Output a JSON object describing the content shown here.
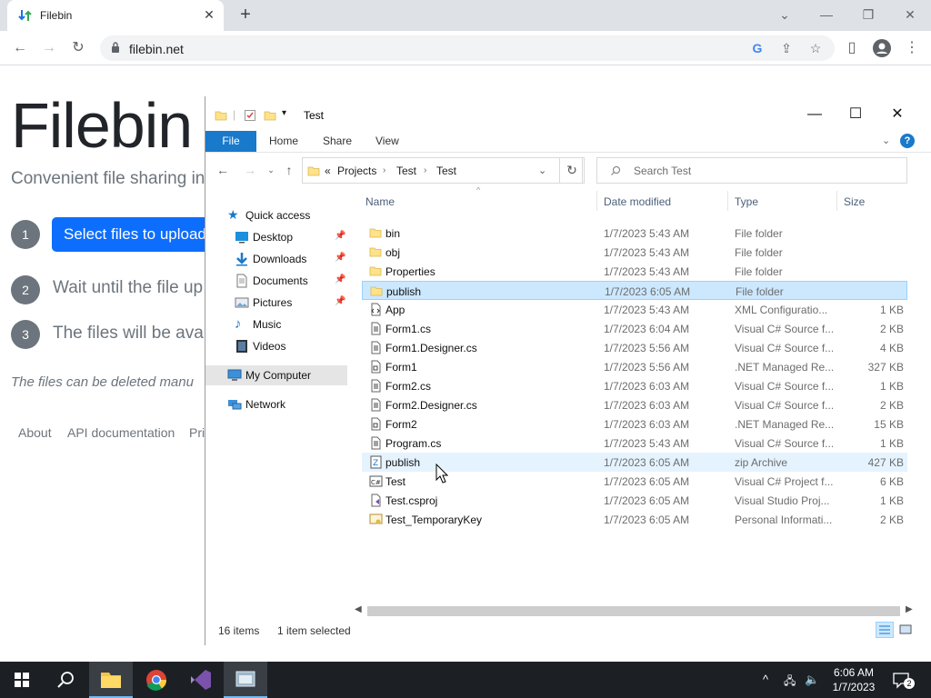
{
  "browser": {
    "tab_title": "Filebin",
    "tab_close": "✕",
    "new_tab": "+",
    "url": "filebin.net"
  },
  "page": {
    "title": "Filebin",
    "tagline": "Convenient file sharing in",
    "steps": [
      {
        "num": "1",
        "label": "Select files to upload"
      },
      {
        "num": "2",
        "label": "Wait until the file up"
      },
      {
        "num": "3",
        "label": "The files will be avai"
      }
    ],
    "note": "The files can be deleted manu",
    "footer_links": [
      "About",
      "API documentation",
      "Pri"
    ]
  },
  "explorer": {
    "title": "Test",
    "ribbon": {
      "file": "File",
      "home": "Home",
      "share": "Share",
      "view": "View",
      "help": "?"
    },
    "address": {
      "prefix": "«",
      "crumbs": [
        "Projects",
        "Test",
        "Test"
      ]
    },
    "search_placeholder": "Search Test",
    "nav": [
      {
        "label": "Quick access",
        "icon": "star-icon",
        "pinned": false
      },
      {
        "label": "Desktop",
        "icon": "desktop-icon",
        "pinned": true
      },
      {
        "label": "Downloads",
        "icon": "download-icon",
        "pinned": true
      },
      {
        "label": "Documents",
        "icon": "document-icon",
        "pinned": true
      },
      {
        "label": "Pictures",
        "icon": "pictures-icon",
        "pinned": true
      },
      {
        "label": "Music",
        "icon": "music-icon",
        "pinned": false
      },
      {
        "label": "Videos",
        "icon": "video-icon",
        "pinned": false
      },
      {
        "label": "My Computer",
        "icon": "computer-icon",
        "pinned": false
      },
      {
        "label": "Network",
        "icon": "network-icon",
        "pinned": false
      }
    ],
    "columns": {
      "name": "Name",
      "date": "Date modified",
      "type": "Type",
      "size": "Size"
    },
    "files": [
      {
        "name": "bin",
        "date": "1/7/2023 5:43 AM",
        "type": "File folder",
        "size": "",
        "icon": "folder-icon"
      },
      {
        "name": "obj",
        "date": "1/7/2023 5:43 AM",
        "type": "File folder",
        "size": "",
        "icon": "folder-icon"
      },
      {
        "name": "Properties",
        "date": "1/7/2023 5:43 AM",
        "type": "File folder",
        "size": "",
        "icon": "folder-icon"
      },
      {
        "name": "publish",
        "date": "1/7/2023 6:05 AM",
        "type": "File folder",
        "size": "",
        "icon": "folder-icon"
      },
      {
        "name": "App",
        "date": "1/7/2023 5:43 AM",
        "type": "XML Configuratio...",
        "size": "1 KB",
        "icon": "xml-config-icon"
      },
      {
        "name": "Form1.cs",
        "date": "1/7/2023 6:04 AM",
        "type": "Visual C# Source f...",
        "size": "2 KB",
        "icon": "cs-file-icon"
      },
      {
        "name": "Form1.Designer.cs",
        "date": "1/7/2023 5:56 AM",
        "type": "Visual C# Source f...",
        "size": "4 KB",
        "icon": "cs-file-icon"
      },
      {
        "name": "Form1",
        "date": "1/7/2023 5:56 AM",
        "type": ".NET Managed Re...",
        "size": "327 KB",
        "icon": "resx-icon"
      },
      {
        "name": "Form2.cs",
        "date": "1/7/2023 6:03 AM",
        "type": "Visual C# Source f...",
        "size": "1 KB",
        "icon": "cs-file-icon"
      },
      {
        "name": "Form2.Designer.cs",
        "date": "1/7/2023 6:03 AM",
        "type": "Visual C# Source f...",
        "size": "2 KB",
        "icon": "cs-file-icon"
      },
      {
        "name": "Form2",
        "date": "1/7/2023 6:03 AM",
        "type": ".NET Managed Re...",
        "size": "15 KB",
        "icon": "resx-icon"
      },
      {
        "name": "Program.cs",
        "date": "1/7/2023 5:43 AM",
        "type": "Visual C# Source f...",
        "size": "1 KB",
        "icon": "cs-file-icon"
      },
      {
        "name": "publish",
        "date": "1/7/2023 6:05 AM",
        "type": "zip Archive",
        "size": "427 KB",
        "icon": "zip-icon"
      },
      {
        "name": "Test",
        "date": "1/7/2023 6:05 AM",
        "type": "Visual C# Project f...",
        "size": "6 KB",
        "icon": "csproj-icon"
      },
      {
        "name": "Test.csproj",
        "date": "1/7/2023 6:05 AM",
        "type": "Visual Studio Proj...",
        "size": "1 KB",
        "icon": "vs-project-icon"
      },
      {
        "name": "Test_TemporaryKey",
        "date": "1/7/2023 6:05 AM",
        "type": "Personal Informati...",
        "size": "2 KB",
        "icon": "certificate-icon"
      }
    ],
    "status": {
      "count": "16 items",
      "selected": "1 item selected"
    }
  },
  "taskbar": {
    "time": "6:06 AM",
    "date": "1/7/2023",
    "notifications": "2"
  },
  "colors": {
    "accent": "#1979ca",
    "selection": "#cce8ff",
    "filebin_blue": "#0d6efd"
  }
}
